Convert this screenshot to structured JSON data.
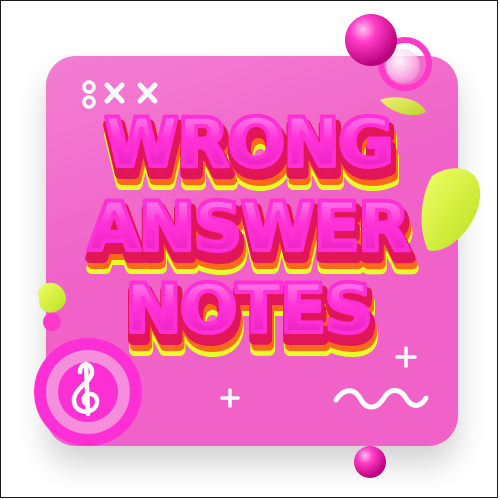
{
  "title": {
    "line1": "WRONG",
    "line2": "ANSWER",
    "line3": "NOTES"
  },
  "colors": {
    "background": "#ffffff",
    "card": "#f062c8",
    "letter_face": "#ff2fd6",
    "letter_highlight": "#ff8ef0",
    "letter_side": "#e0155a",
    "letter_deep": "#ff6a1a",
    "letter_glow": "#e6ff2a",
    "sphere": "#ff1fb6",
    "lime": "#d8f53a",
    "ring": "#ff39c8",
    "symbols": "#ffffff"
  },
  "icons": {
    "top_left_symbols": "circles-and-crosses-icon",
    "badge": "treble-clef-icon",
    "plus_marks": "plus-icon",
    "wave": "squiggle-wave-icon"
  }
}
